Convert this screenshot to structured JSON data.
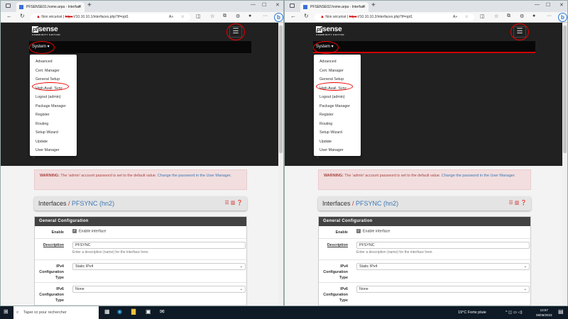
{
  "windows": [
    {
      "tab_title": "PFSENSE01.home.arpa - Interfac",
      "security": "Non sécurisé",
      "url_scheme": "https",
      "url_rest": "://10.10.10.1/interfaces.php?if=opt1",
      "nav_red_line": false
    },
    {
      "tab_title": "PFSENSE02.home.arpa - Interfac",
      "security": "Non sécurisé",
      "url_scheme": "https",
      "url_rest": "://10.10.10.2/interfaces.php?if=opt1",
      "nav_red_line": true
    }
  ],
  "page": {
    "logo_text": "sense",
    "logo_pf": "pf",
    "logo_edition": "COMMUNITY EDITION",
    "menu_label": "System ▾",
    "menu_items": [
      "Advanced",
      "Cert. Manager",
      "General Setup",
      "High Avail. Sync",
      "Logout (admin)",
      "Package Manager",
      "Register",
      "Routing",
      "Setup Wizard",
      "Update",
      "User Manager"
    ],
    "warning_strong": "WARNING:",
    "warning_text": " The 'admin' account password is set to the default value. ",
    "warning_link": "Change the password in the User Manager.",
    "breadcrumb_root": "Interfaces",
    "breadcrumb_sep": " / ",
    "breadcrumb_current": "PFSYNC (hn2)",
    "panel_title": "General Configuration",
    "enable_label": "Enable",
    "enable_checkbox": "Enable interface",
    "enable_checked": true,
    "description_label": "Description",
    "description_value": "PFSYNC",
    "description_help": "Enter a description (name) for the interface here.",
    "ipv4_label": "IPv4 Configuration Type",
    "ipv4_value": "Static IPv4",
    "ipv6_label": "IPv6 Configuration Type",
    "ipv6_value": "None"
  },
  "taskbar": {
    "search_placeholder": "Taper ici pour rechercher",
    "weather": "19°C  Forte pluie",
    "time": "13:57",
    "date": "08/06/2023"
  },
  "colors": {
    "accent_red": "#d20000",
    "link": "#3c78b4",
    "header_dark": "#212121"
  }
}
